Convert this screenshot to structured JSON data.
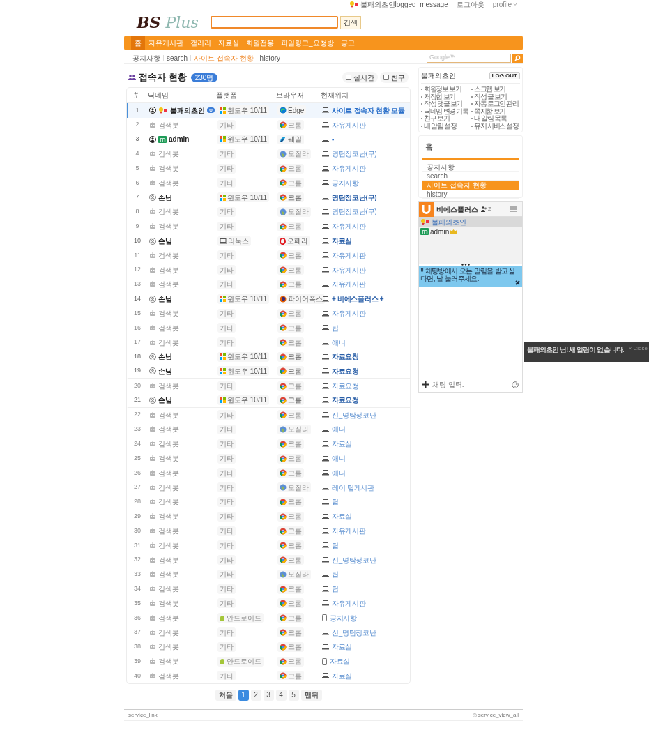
{
  "top_links": {
    "user": "불패의초인logged_message",
    "logout": "로그아웃",
    "profile": "profile"
  },
  "logo": {
    "part1": "BS",
    "part2": "Plus"
  },
  "search": {
    "button": "검색"
  },
  "nav": [
    {
      "label": "홈",
      "selected": true
    },
    {
      "label": "자유게시판",
      "selected": false
    },
    {
      "label": "갤러리",
      "selected": false
    },
    {
      "label": "자료실",
      "selected": false
    },
    {
      "label": "회원전용",
      "selected": false
    },
    {
      "label": "파일링크_요청방",
      "selected": false
    },
    {
      "label": "공고",
      "selected": false
    }
  ],
  "breadcrumb": [
    {
      "label": "공지사항",
      "selected": false
    },
    {
      "label": "search",
      "selected": false
    },
    {
      "label": "사이트 접속자 현황",
      "selected": true
    },
    {
      "label": "history",
      "selected": false
    }
  ],
  "google_search": {
    "placeholder": "Google™"
  },
  "page_title": "접속자 현황",
  "count_badge": "230명",
  "filters": [
    {
      "label": "실시간",
      "checked": false
    },
    {
      "label": "친구",
      "checked": false
    }
  ],
  "table": {
    "columns": [
      "#",
      "닉네임",
      "플랫폼",
      "브라우저",
      "현재위치"
    ],
    "rows": [
      {
        "num": "1",
        "kind": "member",
        "nick": "불패의초인",
        "platform": {
          "kind": "windows",
          "label": "윈도우 10/11"
        },
        "browser": {
          "kind": "edge",
          "label": "Edge"
        },
        "location": {
          "kind": "pc",
          "label": "사이트 접속자 현황 모듈"
        },
        "selected": true
      },
      {
        "num": "2",
        "kind": "bot",
        "nick": "검색봇",
        "platform": {
          "kind": "other",
          "label": "기타"
        },
        "browser": {
          "kind": "chrome",
          "label": "크롬"
        },
        "location": {
          "kind": "pc",
          "label": "자유게시판"
        },
        "selected": false
      },
      {
        "num": "3",
        "kind": "admin",
        "nick": "admin",
        "platform": {
          "kind": "windows",
          "label": "윈도우 10/11"
        },
        "browser": {
          "kind": "whale",
          "label": "웨일"
        },
        "location": {
          "kind": "pc",
          "label": "-"
        },
        "selected": false
      },
      {
        "num": "4",
        "kind": "bot",
        "nick": "검색봇",
        "platform": {
          "kind": "other",
          "label": "기타"
        },
        "browser": {
          "kind": "mozilla",
          "label": "모질라"
        },
        "location": {
          "kind": "pc",
          "label": "명탐정코난(구)"
        },
        "selected": false
      },
      {
        "num": "5",
        "kind": "bot",
        "nick": "검색봇",
        "platform": {
          "kind": "other",
          "label": "기타"
        },
        "browser": {
          "kind": "chrome",
          "label": "크롬"
        },
        "location": {
          "kind": "pc",
          "label": "자유게시판"
        },
        "selected": false
      },
      {
        "num": "6",
        "kind": "bot",
        "nick": "검색봇",
        "platform": {
          "kind": "other",
          "label": "기타"
        },
        "browser": {
          "kind": "chrome",
          "label": "크롬"
        },
        "location": {
          "kind": "pc",
          "label": "공지사항"
        },
        "selected": false
      },
      {
        "num": "7",
        "kind": "guest",
        "nick": "손님",
        "platform": {
          "kind": "windows",
          "label": "윈도우 10/11"
        },
        "browser": {
          "kind": "chrome",
          "label": "크롬"
        },
        "location": {
          "kind": "pc",
          "label": "명탐정코난(구)"
        },
        "selected": false
      },
      {
        "num": "8",
        "kind": "bot",
        "nick": "검색봇",
        "platform": {
          "kind": "other",
          "label": "기타"
        },
        "browser": {
          "kind": "mozilla",
          "label": "모질라"
        },
        "location": {
          "kind": "pc",
          "label": "명탐정코난(구)"
        },
        "selected": false
      },
      {
        "num": "9",
        "kind": "bot",
        "nick": "검색봇",
        "platform": {
          "kind": "other",
          "label": "기타"
        },
        "browser": {
          "kind": "chrome",
          "label": "크롬"
        },
        "location": {
          "kind": "pc",
          "label": "자유게시판"
        },
        "selected": false
      },
      {
        "num": "10",
        "kind": "guest",
        "nick": "손님",
        "platform": {
          "kind": "linux",
          "label": "리눅스"
        },
        "browser": {
          "kind": "opera",
          "label": "오페라"
        },
        "location": {
          "kind": "pc",
          "label": "자료실"
        },
        "selected": false
      },
      {
        "num": "11",
        "kind": "bot",
        "nick": "검색봇",
        "platform": {
          "kind": "other",
          "label": "기타"
        },
        "browser": {
          "kind": "chrome",
          "label": "크롬"
        },
        "location": {
          "kind": "pc",
          "label": "자유게시판"
        },
        "selected": false
      },
      {
        "num": "12",
        "kind": "bot",
        "nick": "검색봇",
        "platform": {
          "kind": "other",
          "label": "기타"
        },
        "browser": {
          "kind": "chrome",
          "label": "크롬"
        },
        "location": {
          "kind": "pc",
          "label": "자유게시판"
        },
        "selected": false
      },
      {
        "num": "13",
        "kind": "bot",
        "nick": "검색봇",
        "platform": {
          "kind": "other",
          "label": "기타"
        },
        "browser": {
          "kind": "chrome",
          "label": "크롬"
        },
        "location": {
          "kind": "pc",
          "label": "자유게시판"
        },
        "selected": false
      },
      {
        "num": "14",
        "kind": "guest",
        "nick": "손님",
        "platform": {
          "kind": "windows",
          "label": "윈도우 10/11"
        },
        "browser": {
          "kind": "firefox",
          "label": "파이어폭스"
        },
        "location": {
          "kind": "pc",
          "label": "+ 비에스플러스 +"
        },
        "selected": false
      },
      {
        "num": "15",
        "kind": "bot",
        "nick": "검색봇",
        "platform": {
          "kind": "other",
          "label": "기타"
        },
        "browser": {
          "kind": "chrome",
          "label": "크롬"
        },
        "location": {
          "kind": "pc",
          "label": "자유게시판"
        },
        "selected": false
      },
      {
        "num": "16",
        "kind": "bot",
        "nick": "검색봇",
        "platform": {
          "kind": "other",
          "label": "기타"
        },
        "browser": {
          "kind": "chrome",
          "label": "크롬"
        },
        "location": {
          "kind": "pc",
          "label": "팁"
        },
        "selected": false
      },
      {
        "num": "17",
        "kind": "bot",
        "nick": "검색봇",
        "platform": {
          "kind": "other",
          "label": "기타"
        },
        "browser": {
          "kind": "chrome",
          "label": "크롬"
        },
        "location": {
          "kind": "pc",
          "label": "애니"
        },
        "selected": false
      },
      {
        "num": "18",
        "kind": "guest",
        "nick": "손님",
        "platform": {
          "kind": "windows",
          "label": "윈도우 10/11"
        },
        "browser": {
          "kind": "chrome",
          "label": "크롬"
        },
        "location": {
          "kind": "pc",
          "label": "자료요청"
        },
        "selected": false
      },
      {
        "num": "19",
        "kind": "guest",
        "nick": "손님",
        "platform": {
          "kind": "windows",
          "label": "윈도우 10/11"
        },
        "browser": {
          "kind": "chrome",
          "label": "크롬"
        },
        "location": {
          "kind": "pc",
          "label": "자료요청"
        },
        "selected": false
      },
      {
        "num": "20",
        "kind": "bot",
        "nick": "검색봇",
        "platform": {
          "kind": "other",
          "label": "기타"
        },
        "browser": {
          "kind": "chrome",
          "label": "크롬"
        },
        "location": {
          "kind": "pc",
          "label": "자료요청"
        },
        "selected": false
      },
      {
        "num": "21",
        "kind": "guest",
        "nick": "손님",
        "platform": {
          "kind": "windows",
          "label": "윈도우 10/11"
        },
        "browser": {
          "kind": "chrome",
          "label": "크롬"
        },
        "location": {
          "kind": "pc",
          "label": "자료요청"
        },
        "selected": false
      },
      {
        "num": "22",
        "kind": "bot",
        "nick": "검색봇",
        "platform": {
          "kind": "other",
          "label": "기타"
        },
        "browser": {
          "kind": "chrome",
          "label": "크롬"
        },
        "location": {
          "kind": "pc",
          "label": "신_명탐정코난"
        },
        "selected": false
      },
      {
        "num": "23",
        "kind": "bot",
        "nick": "검색봇",
        "platform": {
          "kind": "other",
          "label": "기타"
        },
        "browser": {
          "kind": "mozilla",
          "label": "모질라"
        },
        "location": {
          "kind": "pc",
          "label": "애니"
        },
        "selected": false
      },
      {
        "num": "24",
        "kind": "bot",
        "nick": "검색봇",
        "platform": {
          "kind": "other",
          "label": "기타"
        },
        "browser": {
          "kind": "chrome",
          "label": "크롬"
        },
        "location": {
          "kind": "pc",
          "label": "자료실"
        },
        "selected": false
      },
      {
        "num": "25",
        "kind": "bot",
        "nick": "검색봇",
        "platform": {
          "kind": "other",
          "label": "기타"
        },
        "browser": {
          "kind": "chrome",
          "label": "크롬"
        },
        "location": {
          "kind": "pc",
          "label": "애니"
        },
        "selected": false
      },
      {
        "num": "26",
        "kind": "bot",
        "nick": "검색봇",
        "platform": {
          "kind": "other",
          "label": "기타"
        },
        "browser": {
          "kind": "chrome",
          "label": "크롬"
        },
        "location": {
          "kind": "pc",
          "label": "애니"
        },
        "selected": false
      },
      {
        "num": "27",
        "kind": "bot",
        "nick": "검색봇",
        "platform": {
          "kind": "other",
          "label": "기타"
        },
        "browser": {
          "kind": "mozilla",
          "label": "모질라"
        },
        "location": {
          "kind": "pc",
          "label": "레이 팁게시판"
        },
        "selected": false
      },
      {
        "num": "28",
        "kind": "bot",
        "nick": "검색봇",
        "platform": {
          "kind": "other",
          "label": "기타"
        },
        "browser": {
          "kind": "chrome",
          "label": "크롬"
        },
        "location": {
          "kind": "pc",
          "label": "팁"
        },
        "selected": false
      },
      {
        "num": "29",
        "kind": "bot",
        "nick": "검색봇",
        "platform": {
          "kind": "other",
          "label": "기타"
        },
        "browser": {
          "kind": "chrome",
          "label": "크롬"
        },
        "location": {
          "kind": "pc",
          "label": "자료실"
        },
        "selected": false
      },
      {
        "num": "30",
        "kind": "bot",
        "nick": "검색봇",
        "platform": {
          "kind": "other",
          "label": "기타"
        },
        "browser": {
          "kind": "chrome",
          "label": "크롬"
        },
        "location": {
          "kind": "pc",
          "label": "자유게시판"
        },
        "selected": false
      },
      {
        "num": "31",
        "kind": "bot",
        "nick": "검색봇",
        "platform": {
          "kind": "other",
          "label": "기타"
        },
        "browser": {
          "kind": "chrome",
          "label": "크롬"
        },
        "location": {
          "kind": "pc",
          "label": "팁"
        },
        "selected": false
      },
      {
        "num": "32",
        "kind": "bot",
        "nick": "검색봇",
        "platform": {
          "kind": "other",
          "label": "기타"
        },
        "browser": {
          "kind": "chrome",
          "label": "크롬"
        },
        "location": {
          "kind": "pc",
          "label": "신_명탐정코난"
        },
        "selected": false
      },
      {
        "num": "33",
        "kind": "bot",
        "nick": "검색봇",
        "platform": {
          "kind": "other",
          "label": "기타"
        },
        "browser": {
          "kind": "mozilla",
          "label": "모질라"
        },
        "location": {
          "kind": "pc",
          "label": "팁"
        },
        "selected": false
      },
      {
        "num": "34",
        "kind": "bot",
        "nick": "검색봇",
        "platform": {
          "kind": "other",
          "label": "기타"
        },
        "browser": {
          "kind": "chrome",
          "label": "크롬"
        },
        "location": {
          "kind": "pc",
          "label": "팁"
        },
        "selected": false
      },
      {
        "num": "35",
        "kind": "bot",
        "nick": "검색봇",
        "platform": {
          "kind": "other",
          "label": "기타"
        },
        "browser": {
          "kind": "chrome",
          "label": "크롬"
        },
        "location": {
          "kind": "pc",
          "label": "자유게시판"
        },
        "selected": false
      },
      {
        "num": "36",
        "kind": "bot",
        "nick": "검색봇",
        "platform": {
          "kind": "android",
          "label": "안드로이드"
        },
        "browser": {
          "kind": "chrome",
          "label": "크롬"
        },
        "location": {
          "kind": "mobile",
          "label": "공지사항"
        },
        "selected": false
      },
      {
        "num": "37",
        "kind": "bot",
        "nick": "검색봇",
        "platform": {
          "kind": "other",
          "label": "기타"
        },
        "browser": {
          "kind": "chrome",
          "label": "크롬"
        },
        "location": {
          "kind": "pc",
          "label": "신_명탐정코난"
        },
        "selected": false
      },
      {
        "num": "38",
        "kind": "bot",
        "nick": "검색봇",
        "platform": {
          "kind": "other",
          "label": "기타"
        },
        "browser": {
          "kind": "chrome",
          "label": "크롬"
        },
        "location": {
          "kind": "pc",
          "label": "자료실"
        },
        "selected": false
      },
      {
        "num": "39",
        "kind": "bot",
        "nick": "검색봇",
        "platform": {
          "kind": "android",
          "label": "안드로이드"
        },
        "browser": {
          "kind": "chrome",
          "label": "크롬"
        },
        "location": {
          "kind": "mobile",
          "label": "자료실"
        },
        "selected": false
      },
      {
        "num": "40",
        "kind": "bot",
        "nick": "검색봇",
        "platform": {
          "kind": "other",
          "label": "기타"
        },
        "browser": {
          "kind": "chrome",
          "label": "크롬"
        },
        "location": {
          "kind": "pc",
          "label": "자료실"
        },
        "selected": false
      }
    ]
  },
  "pagination": [
    {
      "label": "처음",
      "kind": "nav",
      "selected": false
    },
    {
      "label": "1",
      "kind": "page",
      "selected": true
    },
    {
      "label": "2",
      "kind": "page",
      "selected": false
    },
    {
      "label": "3",
      "kind": "page",
      "selected": false
    },
    {
      "label": "4",
      "kind": "page",
      "selected": false
    },
    {
      "label": "5",
      "kind": "page",
      "selected": false
    },
    {
      "label": "맨뒤",
      "kind": "nav",
      "selected": false
    }
  ],
  "footer": {
    "left": "service_link",
    "right": "service_view_all"
  },
  "profile_box": {
    "name": "불패의초인",
    "logout": "LOG OUT",
    "links": [
      "회원정보 보기",
      "스크랩 보기",
      "저장함 보기",
      "작성 글 보기",
      "작성 댓글 보기",
      "자동 로그인 관리",
      "닉네임 변경 기록",
      "쪽지함 보기",
      "친구 보기",
      "내 알림 목록",
      "내 알림 설정",
      "유저 서비스 설정"
    ]
  },
  "side_menu": {
    "title": "홈",
    "items": [
      {
        "label": "공지사항",
        "selected": false
      },
      {
        "label": "search",
        "selected": false
      },
      {
        "label": "사이트 접속자 현황",
        "selected": true
      },
      {
        "label": "history",
        "selected": false
      }
    ]
  },
  "chat": {
    "title": "비에스플러스",
    "user_count": "2",
    "users": [
      {
        "name": "불패의초인",
        "kind": "medal",
        "selected": true
      },
      {
        "name": "admin",
        "kind": "m",
        "selected": false
      }
    ],
    "banner": "!! 채팅방에서 오는 알림을 받고싶다면, 날 눌러주세요.",
    "input_placeholder": "채팅 입력."
  },
  "notification": {
    "message": "**불패의초인** 님!  **새 알림이 없습니다.**",
    "close": "× Close"
  }
}
